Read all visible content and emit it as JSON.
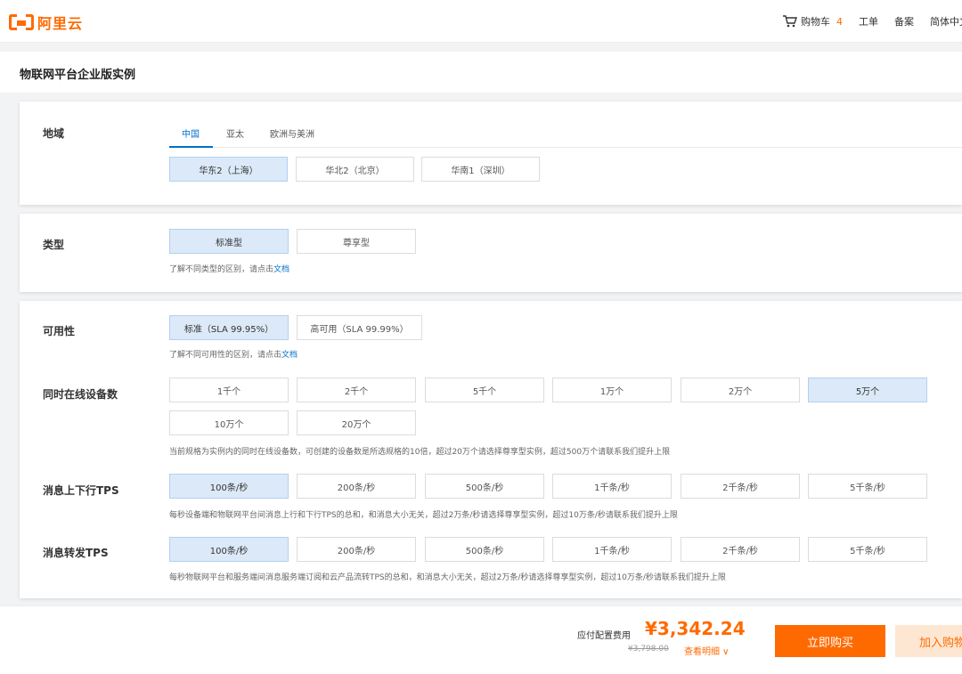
{
  "header": {
    "brand": "阿里云",
    "cart_label": "购物车",
    "cart_count": "4",
    "ticket_label": "工单",
    "filing_label": "备案",
    "lang_label": "简体中文"
  },
  "page_title": "物联网平台企业版实例",
  "region": {
    "label": "地域",
    "tabs": [
      "中国",
      "亚太",
      "欧洲与美洲"
    ],
    "options": [
      "华东2（上海）",
      "华北2（北京）",
      "华南1（深圳）"
    ]
  },
  "type": {
    "label": "类型",
    "options": [
      "标准型",
      "尊享型"
    ],
    "hint_prefix": "了解不同类型的区别，请点击",
    "hint_link": "文档"
  },
  "availability": {
    "label": "可用性",
    "options": [
      "标准（SLA 99.95%）",
      "高可用（SLA 99.99%）"
    ],
    "hint_prefix": "了解不同可用性的区别，请点击",
    "hint_link": "文档"
  },
  "devices": {
    "label": "同时在线设备数",
    "options": [
      "1千个",
      "2千个",
      "5千个",
      "1万个",
      "2万个",
      "5万个",
      "10万个",
      "20万个"
    ],
    "hint": "当前规格为实例内的同时在线设备数，可创建的设备数是所选规格的10倍，超过20万个请选择尊享型实例，超过500万个请联系我们提升上限"
  },
  "upstream_tps": {
    "label": "消息上下行TPS",
    "options": [
      "100条/秒",
      "200条/秒",
      "500条/秒",
      "1千条/秒",
      "2千条/秒",
      "5千条/秒"
    ],
    "hint": "每秒设备端和物联网平台间消息上行和下行TPS的总和，和消息大小无关，超过2万条/秒请选择尊享型实例，超过10万条/秒请联系我们提升上限"
  },
  "forward_tps": {
    "label": "消息转发TPS",
    "options": [
      "100条/秒",
      "200条/秒",
      "500条/秒",
      "1千条/秒",
      "2千条/秒",
      "5千条/秒"
    ],
    "hint": "每秒物联网平台和服务端间消息服务端订阅和云产品流转TPS的总和，和消息大小无关，超过2万条/秒请选择尊享型实例，超过10万条/秒请联系我们提升上限"
  },
  "footer": {
    "fee_label": "应付配置费用",
    "price": "¥3,342.24",
    "original_price": "¥3,798.00",
    "detail_label": "查看明细 ∨",
    "buy_label": "立即购买",
    "add_cart_label": "加入购物车"
  },
  "colors": {
    "accent": "#ff6a00",
    "link": "#0070cc",
    "selected_bg": "#dbe9f8"
  }
}
